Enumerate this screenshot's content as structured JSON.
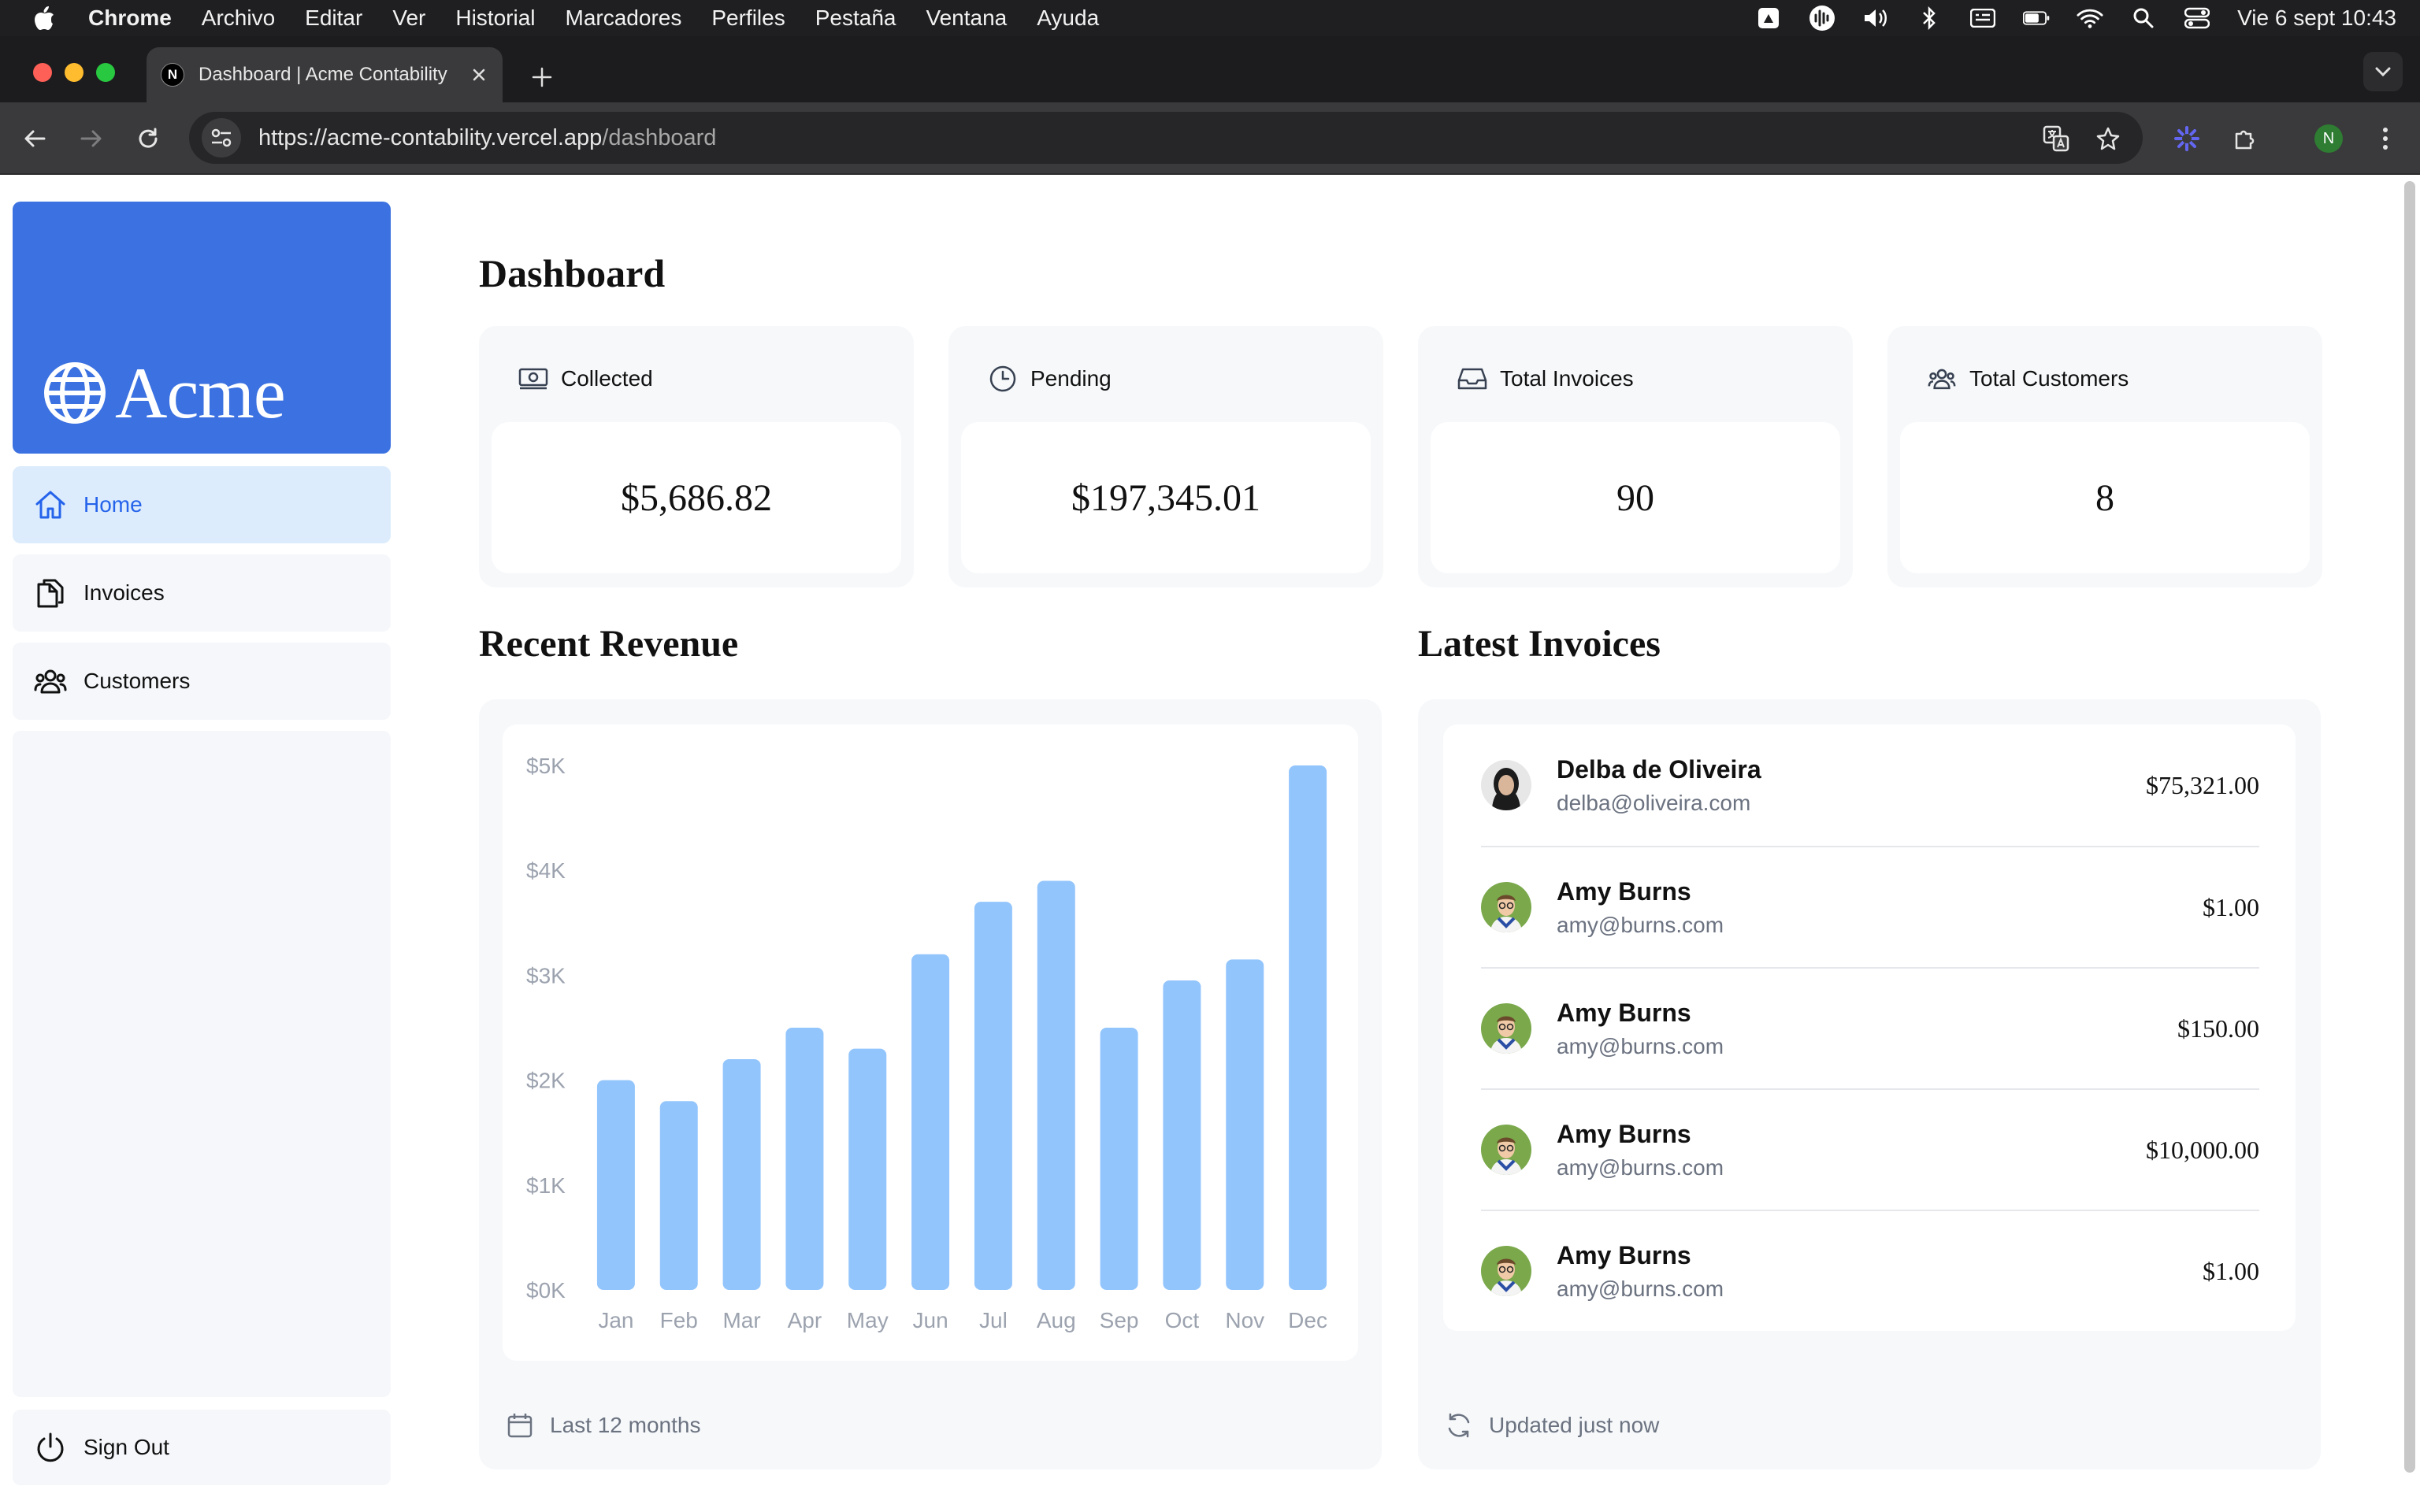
{
  "macos": {
    "app_name": "Chrome",
    "menus": [
      "Archivo",
      "Editar",
      "Ver",
      "Historial",
      "Marcadores",
      "Perfiles",
      "Pestaña",
      "Ventana",
      "Ayuda"
    ],
    "clock": "Vie 6 sept  10:43"
  },
  "browser": {
    "tab_title": "Dashboard | Acme Contability",
    "favicon_letter": "N",
    "url_host": "https://acme-contability.vercel.app",
    "url_path": "/dashboard",
    "profile_initial": "N"
  },
  "sidebar": {
    "brand": "Acme",
    "links": [
      {
        "label": "Home",
        "icon": "home-icon"
      },
      {
        "label": "Invoices",
        "icon": "document-duplicate-icon"
      },
      {
        "label": "Customers",
        "icon": "user-group-icon"
      }
    ],
    "sign_out": "Sign Out"
  },
  "dashboard": {
    "title": "Dashboard",
    "cards": [
      {
        "label": "Collected",
        "value": "$5,686.82",
        "icon": "banknotes-icon"
      },
      {
        "label": "Pending",
        "value": "$197,345.01",
        "icon": "clock-icon"
      },
      {
        "label": "Total Invoices",
        "value": "90",
        "icon": "inbox-icon"
      },
      {
        "label": "Total Customers",
        "value": "8",
        "icon": "user-group-icon"
      }
    ],
    "revenue": {
      "title": "Recent Revenue",
      "footer": "Last 12 months"
    },
    "latest": {
      "title": "Latest Invoices",
      "footer": "Updated just now",
      "invoices": [
        {
          "name": "Delba de Oliveira",
          "email": "delba@oliveira.com",
          "amount": "$75,321.00"
        },
        {
          "name": "Amy Burns",
          "email": "amy@burns.com",
          "amount": "$1.00"
        },
        {
          "name": "Amy Burns",
          "email": "amy@burns.com",
          "amount": "$150.00"
        },
        {
          "name": "Amy Burns",
          "email": "amy@burns.com",
          "amount": "$10,000.00"
        },
        {
          "name": "Amy Burns",
          "email": "amy@burns.com",
          "amount": "$1.00"
        }
      ]
    }
  },
  "chart_data": {
    "type": "bar",
    "title": "",
    "xlabel": "",
    "ylabel": "",
    "categories": [
      "Jan",
      "Feb",
      "Mar",
      "Apr",
      "May",
      "Jun",
      "Jul",
      "Aug",
      "Sep",
      "Oct",
      "Nov",
      "Dec"
    ],
    "values": [
      2000,
      1800,
      2200,
      2500,
      2300,
      3200,
      3700,
      3900,
      2500,
      2950,
      3150,
      5000
    ],
    "yticks": [
      "$0K",
      "$1K",
      "$2K",
      "$3K",
      "$4K",
      "$5K"
    ],
    "ylim": [
      0,
      5000
    ],
    "bar_color": "#93c5fd",
    "grid": false
  },
  "colors": {
    "accent": "#3b71e0",
    "active_link_bg": "#dcecfc",
    "active_link_text": "#2563eb"
  }
}
